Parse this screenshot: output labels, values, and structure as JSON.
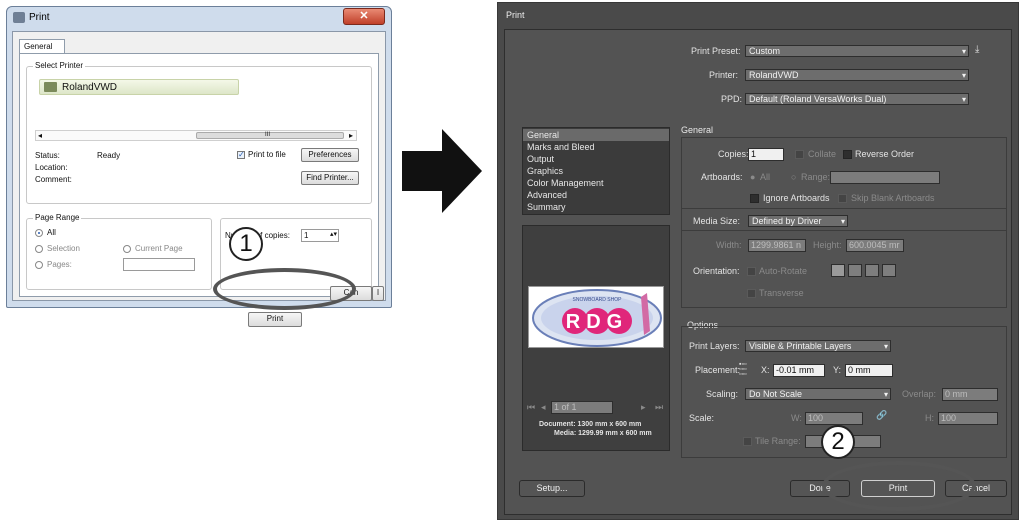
{
  "win": {
    "title": "Print",
    "close_glyph": "✕",
    "tab": "General",
    "select_printer_label": "Select Printer",
    "printer_name": "RolandVWD",
    "scroll_thumb_glyph": "III",
    "status_label": "Status:",
    "status_value": "Ready",
    "location_label": "Location:",
    "comment_label": "Comment:",
    "print_to_file_label": "Print to file",
    "preferences_button": "Preferences",
    "find_printer_button": "Find Printer...",
    "page_range_label": "Page Range",
    "range_all": "All",
    "range_selection": "Selection",
    "range_current_page": "Current Page",
    "range_pages": "Pages:",
    "copies_label": "Number of copies:",
    "copies_value": "1",
    "print_button": "Print",
    "cancel_button": "Can",
    "apply_button": "l"
  },
  "callout1": "1",
  "callout2": "2",
  "ai": {
    "title": "Print",
    "print_preset_label": "Print Preset:",
    "print_preset_value": "Custom",
    "printer_label": "Printer:",
    "printer_value": "RolandVWD",
    "ppd_label": "PPD:",
    "ppd_value": "Default (Roland VersaWorks Dual)",
    "nav": [
      "General",
      "Marks and Bleed",
      "Output",
      "Graphics",
      "Color Management",
      "Advanced",
      "Summary"
    ],
    "general_title": "General",
    "copies_label": "Copies:",
    "copies_value": "1",
    "collate_label": "Collate",
    "reverse_order_label": "Reverse Order",
    "artboards_label": "Artboards:",
    "artboards_all": "All",
    "artboards_range": "Range:",
    "ignore_artboards_label": "Ignore Artboards",
    "skip_blank_label": "Skip Blank Artboards",
    "media_size_label": "Media Size:",
    "media_size_value": "Defined by Driver",
    "width_label": "Width:",
    "width_value": "1299.9861 n",
    "height_label": "Height:",
    "height_value": "600.0045 mr",
    "orientation_label": "Orientation:",
    "auto_rotate_label": "Auto-Rotate",
    "transverse_label": "Transverse",
    "options_title": "Options",
    "print_layers_label": "Print Layers:",
    "print_layers_value": "Visible & Printable Layers",
    "placement_label": "Placement:",
    "x_label": "X:",
    "x_value": "-0.01 mm",
    "y_label": "Y:",
    "y_value": "0 mm",
    "scaling_label": "Scaling:",
    "scaling_value": "Do Not Scale",
    "overlap_label": "Overlap:",
    "overlap_value": "0 mm",
    "scale_label": "Scale:",
    "w_label": "W:",
    "w_value": "100",
    "h_label": "H:",
    "h_value": "100",
    "tile_range_label": "Tile Range:",
    "page_nav_value": "1 of 1",
    "document_size": "Document: 1300 mm x 600 mm",
    "media_size": "Media: 1299.99 mm x 600 mm",
    "logo_text": "RDG",
    "logo_subtext": "SNOWBOARD SHOP",
    "setup_button": "Setup...",
    "done_button": "Done",
    "print_button": "Print",
    "cancel_button": "Cancel"
  }
}
